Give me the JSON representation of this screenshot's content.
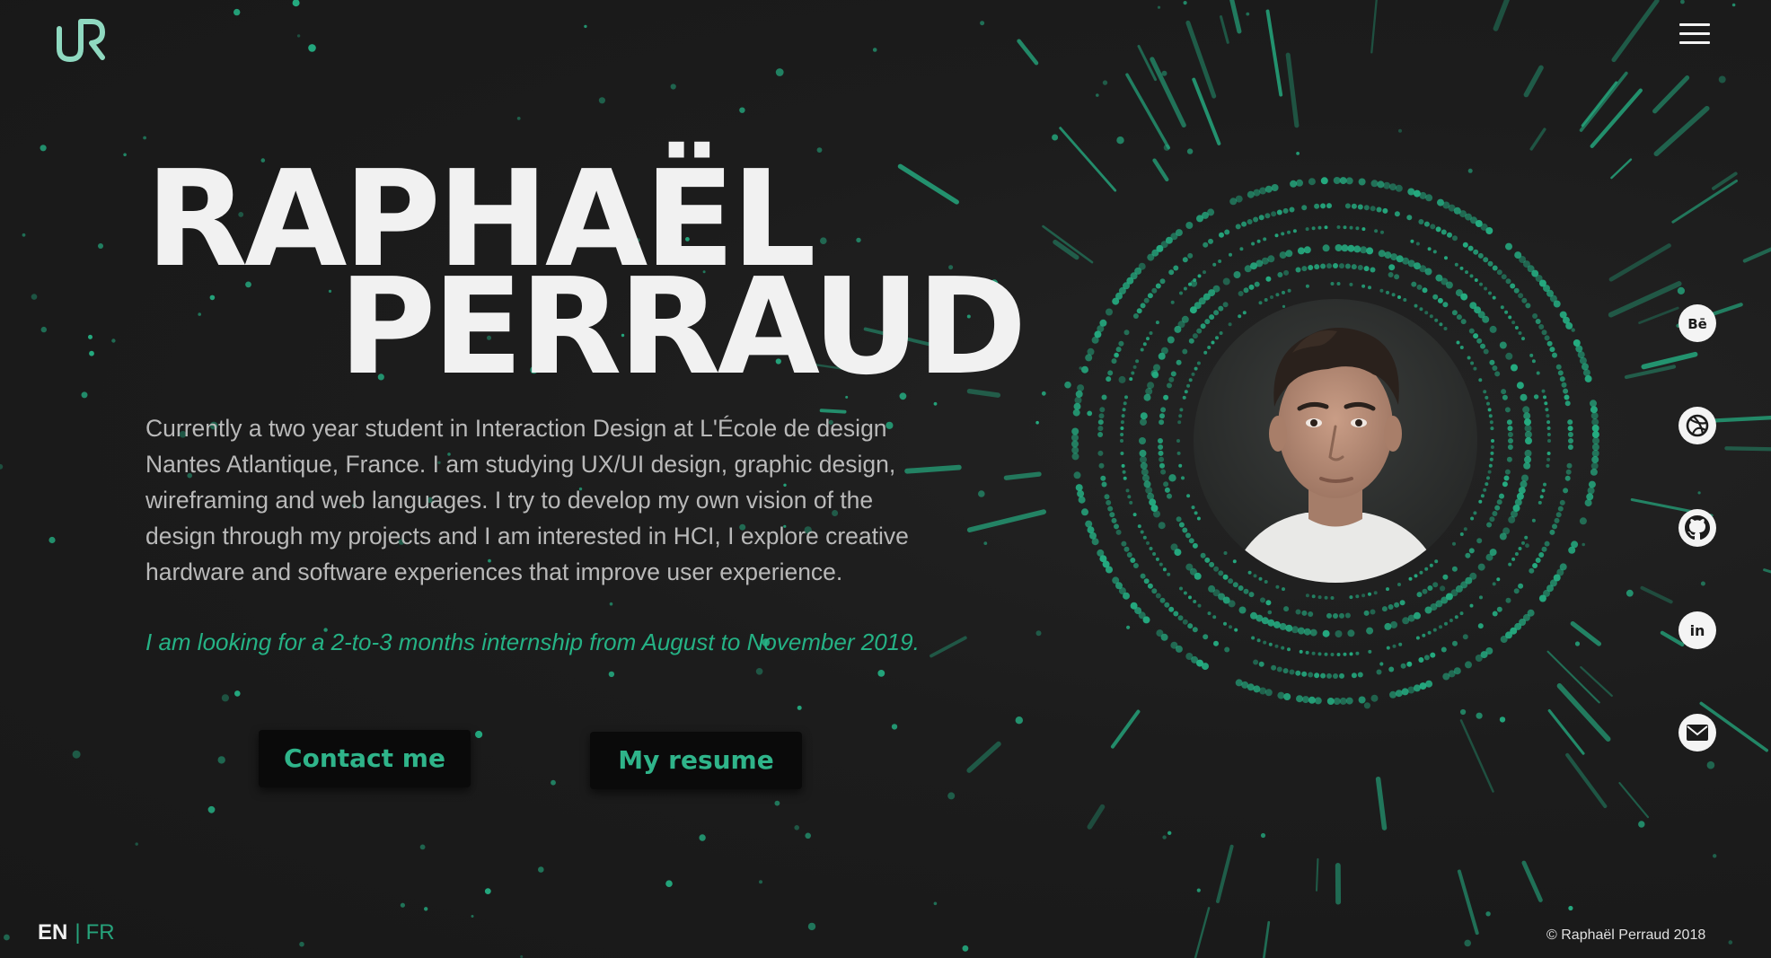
{
  "brand": {
    "logo_text": "uR",
    "accent_color": "#25b285"
  },
  "header": {
    "menu_icon": "hamburger-menu-icon"
  },
  "hero": {
    "first_name": "RAPHAËL",
    "last_name": "PERRAUD",
    "bio": "Currently a two year student in Interaction Design at L'École de design Nantes Atlantique, France. I am studying UX/UI design, graphic design, wireframing and web languages. I try to develop my own vision  of the design through my projects and I am interested in HCI, I explore creative hardware and software experiences that improve user experience.",
    "internship": "I am looking for a 2-to-3 months internship from August to November 2019.",
    "contact_label": "Contact me",
    "resume_label": "My resume"
  },
  "social": [
    {
      "name": "behance-icon",
      "label": "Bē"
    },
    {
      "name": "dribbble-icon"
    },
    {
      "name": "github-icon"
    },
    {
      "name": "linkedin-icon",
      "label": "in"
    },
    {
      "name": "mail-icon"
    }
  ],
  "footer": {
    "lang_en": "EN",
    "lang_sep": "|",
    "lang_fr": "FR",
    "copyright": "© Raphaël Perraud 2018"
  }
}
